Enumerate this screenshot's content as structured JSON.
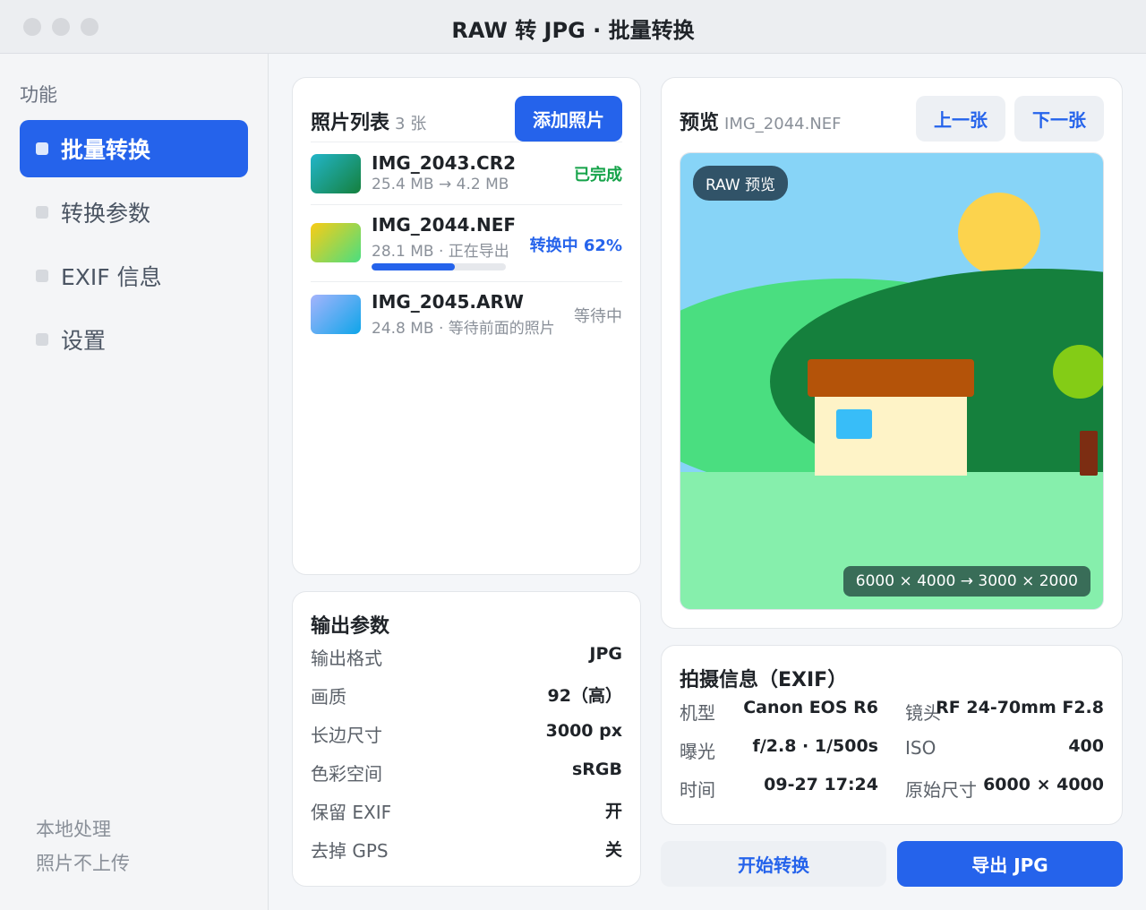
{
  "window": {
    "title": "RAW 转 JPG · 批量转换"
  },
  "sidebar": {
    "section": "功能",
    "items": [
      {
        "label": "批量转换",
        "active": true
      },
      {
        "label": "转换参数",
        "active": false
      },
      {
        "label": "EXIF 信息",
        "active": false
      },
      {
        "label": "设置",
        "active": false
      }
    ],
    "note_line1": "本地处理",
    "note_line2": "照片不上传"
  },
  "photo_list": {
    "title": "照片列表",
    "count": "3 张",
    "add_button": "添加照片",
    "items": [
      {
        "name": "IMG_2043.CR2",
        "meta": "25.4 MB → 4.2 MB",
        "status": "已完成",
        "thumb_colors": [
          "#22b5c9",
          "#15803d"
        ]
      },
      {
        "name": "IMG_2044.NEF",
        "meta": "28.1 MB · 正在导出",
        "status": "转换中 62%",
        "progress": 0.62,
        "thumb_colors": [
          "#facc15",
          "#4ade80"
        ]
      },
      {
        "name": "IMG_2045.ARW",
        "meta": "24.8 MB · 等待前面的照片",
        "status": "等待中",
        "thumb_colors": [
          "#a5b4fc",
          "#0ea5e9"
        ]
      }
    ]
  },
  "output": {
    "title": "输出参数",
    "rows": [
      {
        "key": "输出格式",
        "value": "JPG"
      },
      {
        "key": "画质",
        "value": "92（高）"
      },
      {
        "key": "长边尺寸",
        "value": "3000 px"
      },
      {
        "key": "色彩空间",
        "value": "sRGB"
      },
      {
        "key": "保留 EXIF",
        "value": "开"
      },
      {
        "key": "去掉 GPS",
        "value": "关"
      }
    ]
  },
  "preview": {
    "title": "预览",
    "filename": "IMG_2044.NEF",
    "prev_button": "上一张",
    "next_button": "下一张",
    "badge": "RAW 预览",
    "dimensions": "6000 × 4000 → 3000 × 2000"
  },
  "exif": {
    "title": "拍摄信息（EXIF）",
    "rows": [
      {
        "k1": "机型",
        "v1": "Canon EOS R6",
        "k2": "镜头",
        "v2": "RF 24-70mm F2.8"
      },
      {
        "k1": "曝光",
        "v1": "f/2.8 · 1/500s",
        "k2": "ISO",
        "v2": "400"
      },
      {
        "k1": "时间",
        "v1": "09-27 17:24",
        "k2": "原始尺寸",
        "v2": "6000 × 4000"
      }
    ]
  },
  "actions": {
    "start": "开始转换",
    "export": "导出 JPG"
  },
  "colors": {
    "accent": "#2563eb",
    "done": "#16a34a"
  }
}
